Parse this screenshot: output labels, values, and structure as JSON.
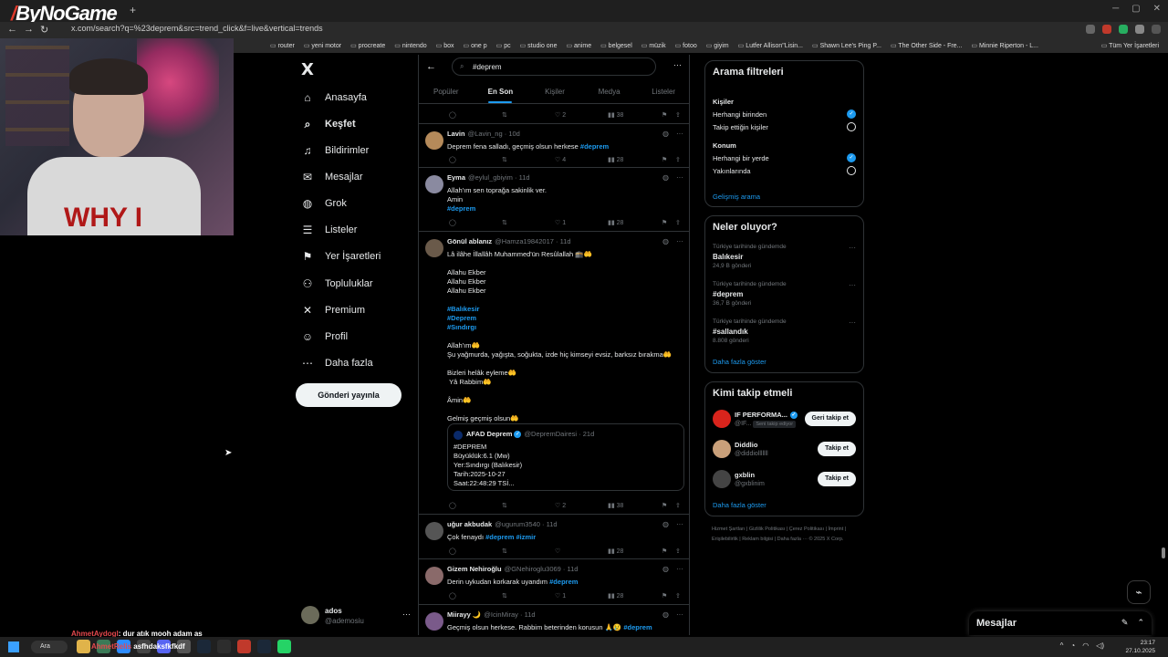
{
  "browser": {
    "brand": "ByNoGame",
    "url": "x.com/search?q=%23deprem&src=trend_click&f=live&vertical=trends",
    "bookmarks": [
      "router",
      "yeni motor",
      "procreate",
      "nintendo",
      "box",
      "one p",
      "pc",
      "studio one",
      "anime",
      "belgesel",
      "müzik",
      "fotoo",
      "giyim",
      "Lutfer Allison\"Lisin...",
      "Shawn Lee's Ping P...",
      "The Other Side - Fre...",
      "Minnie Riperton - L..."
    ],
    "bookmarks_right": "Tüm Yer İşaretleri"
  },
  "webcam": {
    "shirt_text": "WHY I"
  },
  "sidebar": {
    "logo": "X",
    "items": [
      {
        "label": "Anasayfa",
        "icon": "home-icon",
        "glyph": "⌂"
      },
      {
        "label": "Keşfet",
        "icon": "search-icon",
        "glyph": "⌕",
        "active": true
      },
      {
        "label": "Bildirimler",
        "icon": "bell-icon",
        "glyph": "♫"
      },
      {
        "label": "Mesajlar",
        "icon": "mail-icon",
        "glyph": "✉"
      },
      {
        "label": "Grok",
        "icon": "grok-icon",
        "glyph": "◍"
      },
      {
        "label": "Listeler",
        "icon": "list-icon",
        "glyph": "☰"
      },
      {
        "label": "Yer İşaretleri",
        "icon": "bookmark-icon",
        "glyph": "⚑"
      },
      {
        "label": "Topluluklar",
        "icon": "communities-icon",
        "glyph": "⚇"
      },
      {
        "label": "Premium",
        "icon": "x-premium-icon",
        "glyph": "✕"
      },
      {
        "label": "Profil",
        "icon": "profile-icon",
        "glyph": "☺"
      },
      {
        "label": "Daha fazla",
        "icon": "more-icon",
        "glyph": "⋯"
      }
    ],
    "post_button": "Gönderi yayınla",
    "account": {
      "name": "ados",
      "handle": "@ademosiu",
      "more": "···"
    }
  },
  "search": {
    "query": "#deprem",
    "tabs": [
      "Popüler",
      "En Son",
      "Kişiler",
      "Medya",
      "Listeler"
    ],
    "active_tab": "En Son"
  },
  "tweets": [
    {
      "stats": {
        "likes": "2",
        "views": "38"
      }
    },
    {
      "name": "Lavin",
      "handle": "@Lavin_ng",
      "time": "10d",
      "text": "Deprem fena salladı, geçmiş olsun herkese ",
      "tags": "#deprem",
      "stats": {
        "likes": "4",
        "views": "28"
      }
    },
    {
      "name": "Eyma",
      "handle": "@eylul_gbiyim",
      "time": "11d",
      "text": "Allah'ım sen toprağa sakinlik ver.\nAmin\n",
      "tags": "#deprem",
      "stats": {
        "likes": "1",
        "views": "28"
      }
    },
    {
      "name": "Gönül ablanız",
      "handle": "@Hamza19842017",
      "time": "11d",
      "text_a": "Lâ ilâhe İllallâh Muhammed'ün Resûlallah 🕋🤲\n\nAllahu Ekber\nAllahu Ekber\nAllahu Ekber\n\n",
      "tags": "#Balıkesir\n#Deprem\n#Sındırgı",
      "text_b": "\n\nAllah'ım🤲\nŞu yağmurda, yağışta, soğukta, izde hiç kimseyi evsiz, barksız bırakma🤲\n\nBizleri helâk eyleme🤲\n Yâ Rabbim🤲\n\nÂmin🤲\n\nGelmiş geçmiş olsun🤲",
      "quote": {
        "name": "AFAD Deprem",
        "handle": "@DepremDairesi",
        "time": "21d",
        "text": "#DEPREM\nBüyüklük:6.1 (Mw)\nYer:Sındırgı (Balıkesir)\nTarih:2025-10-27\nSaat:22:48:29 TSİ..."
      },
      "stats": {
        "likes": "2",
        "views": "38"
      }
    },
    {
      "name": "uğur akbudak",
      "handle": "@ugurum3540",
      "time": "11d",
      "text": "Çok fenaydı ",
      "tags": "#deprem #izmir",
      "stats": {
        "likes": "",
        "views": "28"
      }
    },
    {
      "name": "Gizem Nehiroğlu",
      "handle": "@GNehiroglu3069",
      "time": "11d",
      "text": "Derin uykudan korkarak uyandım ",
      "tags": "#deprem",
      "stats": {
        "likes": "1",
        "views": "28"
      }
    },
    {
      "name": "Miirayy 🌙",
      "handle": "@IcinMiray",
      "time": "11d",
      "text": "Geçmiş olsun herkese. Rabbim beterinden korusun 🙏😢 ",
      "tags": "#deprem"
    }
  ],
  "filters": {
    "title": "Arama filtreleri",
    "people_label": "Kişiler",
    "people_opts": [
      "Herhangi birinden",
      "Takip ettiğin kişiler"
    ],
    "location_label": "Konum",
    "location_opts": [
      "Herhangi bir yerde",
      "Yakınlarında"
    ],
    "advanced": "Gelişmiş arama"
  },
  "trends": {
    "title": "Neler oluyor?",
    "items": [
      {
        "ctx": "Türkiye tarihinde gündemde",
        "name": "Balıkesir",
        "count": "24,9 B gönderi"
      },
      {
        "ctx": "Türkiye tarihinde gündemde",
        "name": "#deprem",
        "count": "36,7 B gönderi"
      },
      {
        "ctx": "Türkiye tarihinde gündemde",
        "name": "#sallandık",
        "count": "8.808 gönderi"
      }
    ],
    "more": "Daha fazla göster"
  },
  "who_to_follow": {
    "title": "Kimi takip etmeli",
    "items": [
      {
        "name": "IF PERFORMA...",
        "handle": "@IF...",
        "badge": "Seni takip ediyor",
        "button": "Geri takip et"
      },
      {
        "name": "Diddlio",
        "handle": "@diddiolllllll",
        "button": "Takip et"
      },
      {
        "name": "gxblin",
        "handle": "@gxblinim",
        "button": "Takip et"
      }
    ],
    "more": "Daha fazla göster"
  },
  "footer": "Hizmet Şartları | Gizlilik Politikası | Çerez Politikası | İmprint | Erişilebilirlik | Reklam bilgisi | Daha fazla ··· © 2025 X Corp.",
  "messages_dock": {
    "title": "Mesajlar"
  },
  "chat": {
    "user": "AhmetAydogl",
    "message": ": dur atık mooh adam as"
  },
  "taskbar": {
    "search": "Ara",
    "overlay_user": "AhmetRelis",
    "overlay_msg": " asfhdaksfkfkdf",
    "time": "23:17",
    "date": "27.10.2025"
  },
  "colors": {
    "accent": "#1d9bf0",
    "bg": "#000000",
    "border": "#2f3336",
    "muted": "#71767b"
  }
}
